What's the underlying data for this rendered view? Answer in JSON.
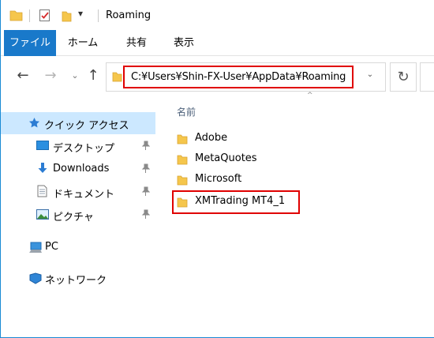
{
  "window": {
    "title": "Roaming",
    "accent_color": "#1979ca",
    "highlight_color": "#e00000"
  },
  "quick_access_toolbar": {
    "customize_glyph": "▾"
  },
  "ribbon": {
    "tabs": [
      {
        "label": "ファイル",
        "active": true
      },
      {
        "label": "ホーム",
        "active": false
      },
      {
        "label": "共有",
        "active": false
      },
      {
        "label": "表示",
        "active": false
      }
    ]
  },
  "navigation": {
    "back_glyph": "←",
    "forward_glyph": "→",
    "recent_glyph": "⌄",
    "up_glyph": "↑",
    "refresh_glyph": "↻",
    "dropdown_glyph": "⌄"
  },
  "address": {
    "path": "C:¥Users¥Shin-FX-User¥AppData¥Roaming"
  },
  "nav_pane": {
    "quick_access": "クイック アクセス",
    "items": [
      {
        "label": "デスクトップ",
        "icon": "desktop-icon",
        "pinned": true
      },
      {
        "label": "Downloads",
        "icon": "download-icon",
        "pinned": true
      },
      {
        "label": "ドキュメント",
        "icon": "documents-icon",
        "pinned": true
      },
      {
        "label": "ピクチャ",
        "icon": "pictures-icon",
        "pinned": true
      }
    ],
    "pc": "PC",
    "network": "ネットワーク",
    "pin_glyph": "📌"
  },
  "content": {
    "column_header": "名前",
    "sort_glyph": "^",
    "files": [
      {
        "name": "Adobe"
      },
      {
        "name": "MetaQuotes"
      },
      {
        "name": "Microsoft"
      },
      {
        "name": "XMTrading MT4_1",
        "highlighted": true
      }
    ]
  }
}
